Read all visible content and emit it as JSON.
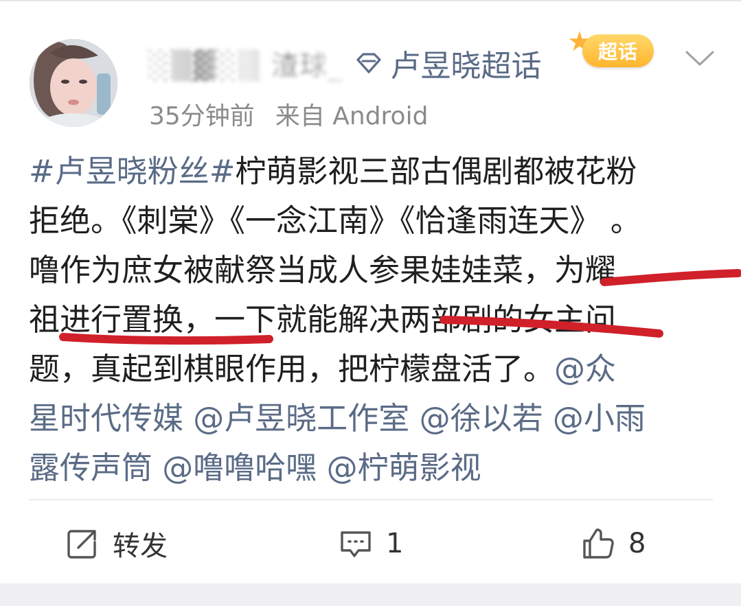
{
  "post": {
    "nickname_obscured": "░▒▓░▒ 渣球_",
    "topic": "卢昱晓超话",
    "time": "35分钟前",
    "source": "来自 Android",
    "badge_label": "超话",
    "content_lines": [
      [
        {
          "t": "#卢昱晓粉丝#",
          "link": true
        },
        {
          "t": "柠萌影视三部古偶剧都被花粉",
          "link": false
        }
      ],
      [
        {
          "t": "拒绝。《刺棠》《一念江南》《恰逢雨连天》 。",
          "link": false
        }
      ],
      [
        {
          "t": "噜作为庶女被献祭当成人参果娃娃菜，为耀",
          "link": false
        }
      ],
      [
        {
          "t": "祖进行置换，一下就能解决两部剧的女主问",
          "link": false
        }
      ],
      [
        {
          "t": "题，真起到棋眼作用，把柠檬盘活了。",
          "link": false
        },
        {
          "t": "@众",
          "link": true
        }
      ],
      [
        {
          "t": "星时代传媒 @卢昱晓工作室 @徐以若 @小雨",
          "link": true
        }
      ],
      [
        {
          "t": "露传声筒 @噜噜哈嘿 @柠萌影视",
          "link": true
        }
      ]
    ]
  },
  "actions": {
    "repost_label": "转发",
    "comment_count": "1",
    "like_count": "8"
  },
  "icons": {
    "topic": "super-topic-diamond-icon",
    "chevron": "chevron-down-icon",
    "repost": "repost-icon",
    "comment": "comment-icon",
    "like": "thumbs-up-icon"
  },
  "colors": {
    "link": "#5a6b86",
    "text": "#1f1f1f",
    "meta": "#8a8a8a",
    "underline": "#d0202a",
    "badge": "#ffb52e"
  }
}
